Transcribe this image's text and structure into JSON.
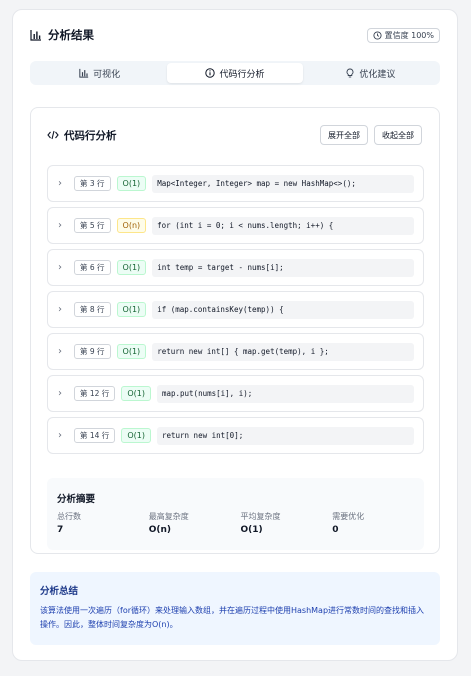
{
  "header": {
    "title": "分析结果",
    "title_icon": "bar-chart-icon",
    "confidence_label": "置信度 100%",
    "confidence_icon": "clock-icon"
  },
  "tabs": [
    {
      "label": "可视化",
      "icon": "bar-chart-icon",
      "active": false
    },
    {
      "label": "代码行分析",
      "icon": "info-icon",
      "active": true
    },
    {
      "label": "优化建议",
      "icon": "lightbulb-icon",
      "active": false
    }
  ],
  "panel": {
    "title": "代码行分析",
    "title_icon": "code-icon",
    "expand_all": "展开全部",
    "collapse_all": "收起全部"
  },
  "rows": [
    {
      "line": "第 3 行",
      "complexity": "O(1)",
      "status": "good",
      "code": "Map<Integer, Integer> map = new HashMap<>();"
    },
    {
      "line": "第 5 行",
      "complexity": "O(n)",
      "status": "warn",
      "code": "for (int i = 0; i < nums.length; i++) {"
    },
    {
      "line": "第 6 行",
      "complexity": "O(1)",
      "status": "good",
      "code": "int temp = target - nums[i];"
    },
    {
      "line": "第 8 行",
      "complexity": "O(1)",
      "status": "good",
      "code": "if (map.containsKey(temp)) {"
    },
    {
      "line": "第 9 行",
      "complexity": "O(1)",
      "status": "good",
      "code": "return new int[] { map.get(temp), i };"
    },
    {
      "line": "第 12 行",
      "complexity": "O(1)",
      "status": "good",
      "code": "map.put(nums[i], i);"
    },
    {
      "line": "第 14 行",
      "complexity": "O(1)",
      "status": "good",
      "code": "return new int[0];"
    }
  ],
  "summary": {
    "title": "分析摘要",
    "stats": [
      {
        "label": "总行数",
        "value": "7"
      },
      {
        "label": "最高复杂度",
        "value": "O(n)"
      },
      {
        "label": "平均复杂度",
        "value": "O(1)"
      },
      {
        "label": "需要优化",
        "value": "0"
      }
    ]
  },
  "conclusion": {
    "title": "分析总结",
    "text": "该算法使用一次遍历（for循环）来处理输入数组，并在遍历过程中使用HashMap进行常数时间的查找和插入操作。因此，整体时间复杂度为O(n)。"
  },
  "colors": {
    "good_bg": "#ecfdf5",
    "warn_bg": "#fefce8",
    "conclusion_bg": "#eff6ff"
  }
}
